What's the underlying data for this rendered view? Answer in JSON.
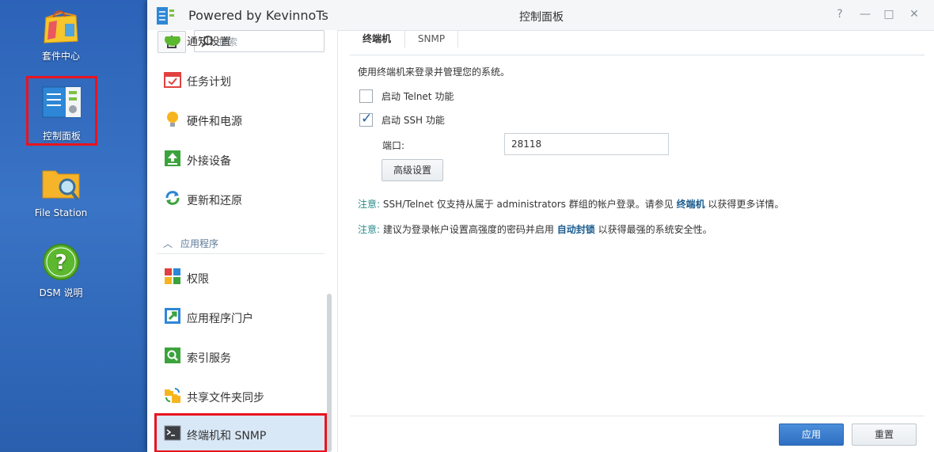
{
  "desktop": {
    "icons": [
      {
        "label": "套件中心"
      },
      {
        "label": "控制面板"
      },
      {
        "label": "File Station"
      },
      {
        "label": "DSM 说明"
      }
    ]
  },
  "window": {
    "title": "Powered by KevinnoTs",
    "center_title": "控制面板",
    "controls": {
      "help": "?",
      "minimize": "—",
      "maximize": "□",
      "close": "✕"
    }
  },
  "sidebar": {
    "search_placeholder": "搜索",
    "items": [
      {
        "label": "通知设置"
      },
      {
        "label": "任务计划"
      },
      {
        "label": "硬件和电源"
      },
      {
        "label": "外接设备"
      },
      {
        "label": "更新和还原"
      }
    ],
    "section_header": "应用程序",
    "app_items": [
      {
        "label": "权限"
      },
      {
        "label": "应用程序门户"
      },
      {
        "label": "索引服务"
      },
      {
        "label": "共享文件夹同步"
      },
      {
        "label": "终端机和 SNMP"
      }
    ]
  },
  "content": {
    "tabs": [
      {
        "label": "终端机"
      },
      {
        "label": "SNMP"
      }
    ],
    "description": "使用终端机来登录并管理您的系统。",
    "telnet": {
      "label": "启动 Telnet 功能",
      "checked": false
    },
    "ssh": {
      "label": "启动 SSH 功能",
      "checked": true
    },
    "port": {
      "label": "端口:",
      "value": "28118"
    },
    "advanced_button": "高级设置",
    "note1": {
      "prefix": "注意:",
      "text_before": "SSH/Telnet 仅支持从属于 administrators 群组的帐户登录。请参见",
      "link": "终端机",
      "text_after": "以获得更多详情。"
    },
    "note2": {
      "prefix": "注意:",
      "text_before": "建议为登录帐户设置高强度的密码并启用",
      "link": "自动封锁",
      "text_after": "以获得最强的系统安全性。"
    },
    "apply_button": "应用",
    "reset_button": "重置"
  },
  "colors": {
    "accent": "#2f6fc2",
    "desktop_bg": "#2f66b5",
    "highlight_box": "#e8141e",
    "active_nav": "#d9e8f7",
    "note_label": "#2e8b8b",
    "link": "#1a5c8f"
  }
}
